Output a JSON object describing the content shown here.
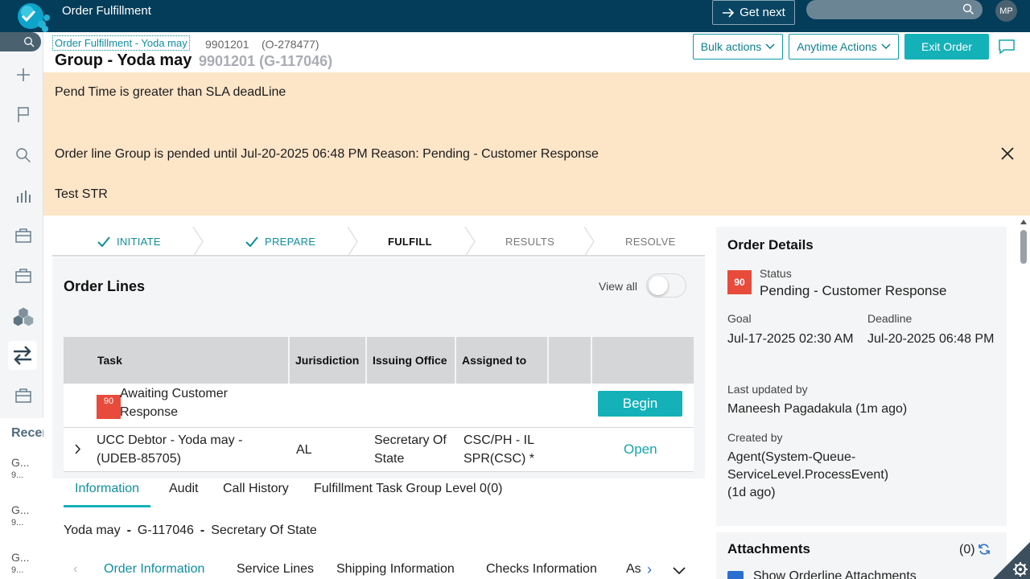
{
  "app": {
    "title": "Order Fulfillment"
  },
  "topbar": {
    "get_next_label": "Get next",
    "search_placeholder": "",
    "avatar_initials": "MP"
  },
  "leftnav": {
    "recent_label": "Recent",
    "recent_items": [
      {
        "title": "G...",
        "sub": "9..."
      },
      {
        "title": "G...",
        "sub": "9..."
      },
      {
        "title": "G...",
        "sub": "9..."
      }
    ]
  },
  "header": {
    "breadcrumb_link": "Order Fulfillment - Yoda may",
    "breadcrumb_id": "9901201",
    "breadcrumb_order": "(O-278477)",
    "title": "Group - Yoda may",
    "subtitle": "9901201 (G-117046)",
    "bulk_actions": "Bulk actions",
    "anytime_actions": "Anytime Actions",
    "exit_order": "Exit Order"
  },
  "alert": {
    "line1": "Pend Time is greater than SLA deadLine",
    "line2": "Order line Group is pended until Jul-20-2025 06:48 PM Reason: Pending - Customer Response",
    "line3": "Test STR"
  },
  "stepper": {
    "steps": [
      {
        "label": "INITIATE",
        "state": "done"
      },
      {
        "label": "PREPARE",
        "state": "done"
      },
      {
        "label": "FULFILL",
        "state": "current"
      },
      {
        "label": "RESULTS",
        "state": "todo"
      },
      {
        "label": "RESOLVE",
        "state": "todo"
      }
    ]
  },
  "order_lines": {
    "title": "Order Lines",
    "view_all": "View all",
    "view_all_on": false,
    "columns": [
      "Task",
      "Jurisdiction",
      "Issuing Office",
      "Assigned to",
      "",
      ""
    ],
    "rows": [
      {
        "badge": "90",
        "task": "Awaiting Customer Response",
        "jurisdiction": "",
        "issuing_office": "",
        "assigned_to": "",
        "action": "Begin"
      },
      {
        "badge": "",
        "task": "UCC Debtor - Yoda may - (UDEB-85705)",
        "jurisdiction": "AL",
        "issuing_office": "Secretary Of State",
        "assigned_to": "CSC/PH - IL SPR(CSC) *",
        "action": "Open"
      }
    ]
  },
  "tabs": {
    "items": [
      "Information",
      "Audit",
      "Call History",
      "Fulfillment Task Group Level 0(0)"
    ],
    "active": "Information"
  },
  "info": {
    "name": "Yoda may",
    "group_id": "G-117046",
    "office": "Secretary Of State",
    "separator": "-"
  },
  "subtabs": {
    "items": [
      "Order Information",
      "Service Lines",
      "Shipping Information",
      "Checks Information",
      "As"
    ],
    "active": "Order Information"
  },
  "order_details": {
    "title": "Order Details",
    "badge": "90",
    "status_label": "Status",
    "status_value": "Pending - Customer Response",
    "goal_label": "Goal",
    "goal_value": "Jul-17-2025 02:30 AM",
    "deadline_label": "Deadline",
    "deadline_value": "Jul-20-2025 06:48 PM",
    "updated_label": "Last updated by",
    "updated_value": "Maneesh Pagadakula (1m ago)",
    "created_label": "Created by",
    "created_value_1": "Agent(System-Queue-",
    "created_value_2": "ServiceLevel.ProcessEvent)",
    "created_value_3": "(1d ago)"
  },
  "attachments": {
    "title": "Attachments",
    "count": "(0)",
    "checkbox_label": "Show Orderline Attachments",
    "checkbox_checked": true
  },
  "colors": {
    "topbar": "#033d5a",
    "accent": "#14b1b8",
    "alert_bg": "#fde5c8",
    "urgency_badge": "#e84b3b"
  }
}
